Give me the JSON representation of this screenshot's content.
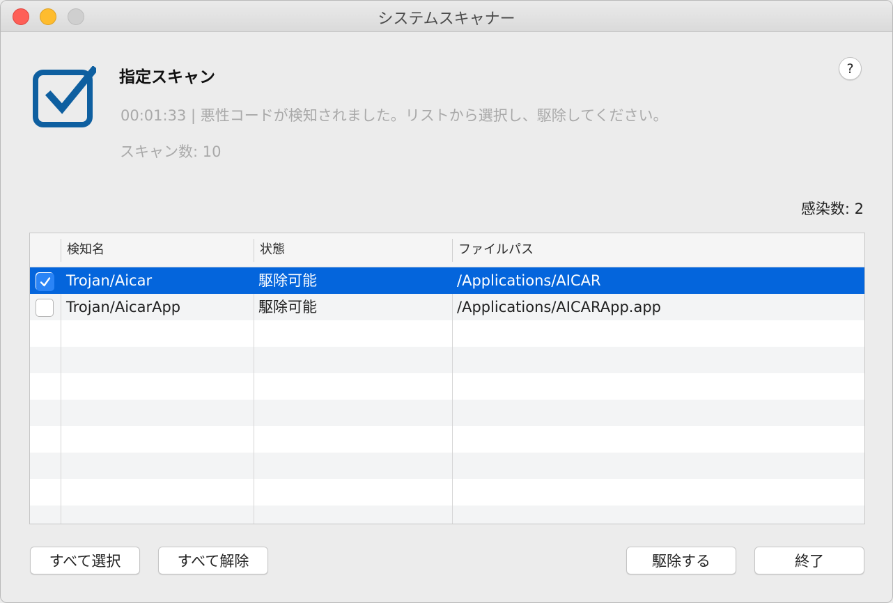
{
  "window": {
    "title": "システムスキャナー"
  },
  "help": {
    "label": "?"
  },
  "header": {
    "icon": "checkbox-check-icon",
    "icon_color": "#0e5fa0",
    "scan_title": "指定スキャン",
    "status": "00:01:33 | 悪性コードが検知されました。リストから選択し、駆除してください。",
    "scan_count": "スキャン数: 10"
  },
  "infected_count": "感染数: 2",
  "table": {
    "columns": [
      "",
      "検知名",
      "状態",
      "ファイルパス"
    ],
    "rows": [
      {
        "checked": true,
        "name": "Trojan/Aicar",
        "status": "駆除可能",
        "path": "/Applications/AICAR",
        "selected": true
      },
      {
        "checked": false,
        "name": "Trojan/AicarApp",
        "status": "駆除可能",
        "path": "/Applications/AICARApp.app",
        "selected": false
      }
    ],
    "selection_color": "#0465dc"
  },
  "buttons": {
    "select_all": "すべて選択",
    "deselect_all": "すべて解除",
    "remove": "駆除する",
    "finish": "終了"
  }
}
